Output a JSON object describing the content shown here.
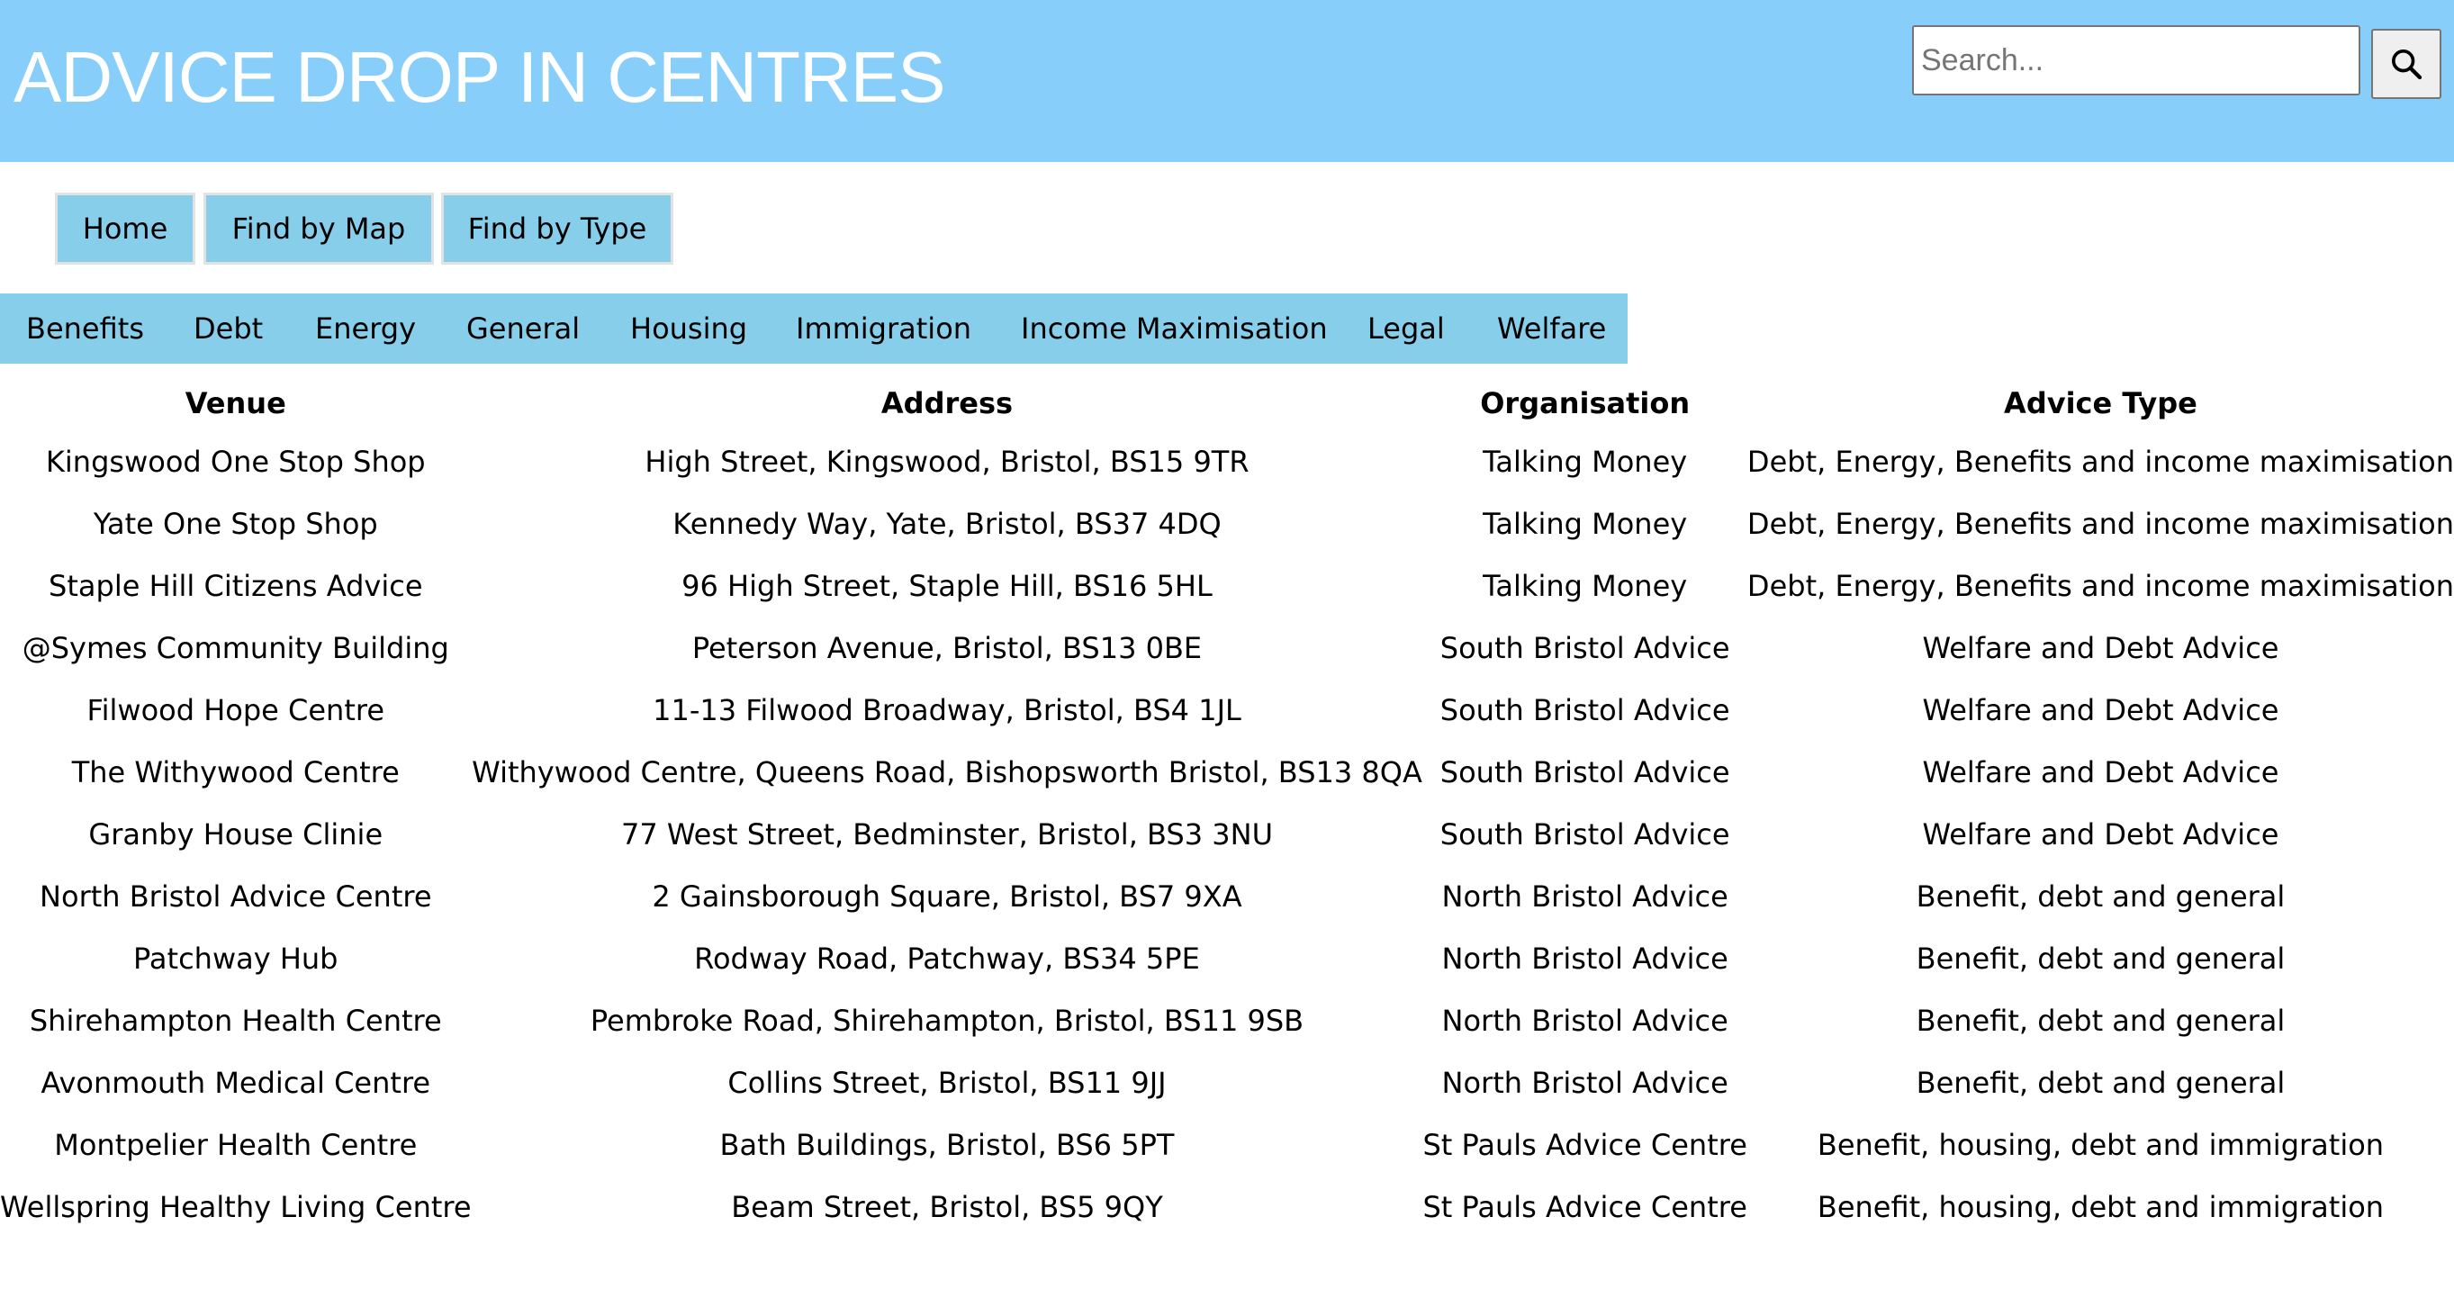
{
  "header": {
    "title": "ADVICE DROP IN CENTRES",
    "search_placeholder": "Search...",
    "search_button_icon": "search-icon",
    "background_color": "#87cefa"
  },
  "nav": {
    "items": [
      {
        "label": "Home"
      },
      {
        "label": "Find by Map"
      },
      {
        "label": "Find by Type"
      }
    ],
    "button_color": "#87ceeb"
  },
  "types": {
    "items": [
      {
        "label": "Benefits"
      },
      {
        "label": "Debt"
      },
      {
        "label": "Energy"
      },
      {
        "label": "General"
      },
      {
        "label": "Housing"
      },
      {
        "label": "Immigration"
      },
      {
        "label": "Income Maximisation"
      },
      {
        "label": "Legal"
      },
      {
        "label": "Welfare"
      }
    ]
  },
  "table": {
    "headers": [
      "Venue",
      "Address",
      "Organisation",
      "Advice Type"
    ],
    "rows": [
      [
        "Kingswood One Stop Shop",
        "High Street, Kingswood, Bristol, BS15 9TR",
        "Talking Money",
        "Debt, Energy, Benefits and income maximisation"
      ],
      [
        "Yate One Stop Shop",
        "Kennedy Way, Yate, Bristol, BS37 4DQ",
        "Talking Money",
        "Debt, Energy, Benefits and income maximisation"
      ],
      [
        "Staple Hill Citizens Advice",
        "96 High Street, Staple Hill, BS16 5HL",
        "Talking Money",
        "Debt, Energy, Benefits and income maximisation"
      ],
      [
        "@Symes Community Building",
        "Peterson Avenue, Bristol, BS13 0BE",
        "South Bristol Advice",
        "Welfare and Debt Advice"
      ],
      [
        "Filwood Hope Centre",
        "11-13 Filwood Broadway, Bristol, BS4 1JL",
        "South Bristol Advice",
        "Welfare and Debt Advice"
      ],
      [
        "The Withywood Centre",
        "Withywood Centre, Queens Road, Bishopsworth Bristol, BS13 8QA",
        "South Bristol Advice",
        "Welfare and Debt Advice"
      ],
      [
        "Granby House Clinie",
        "77 West Street, Bedminster, Bristol, BS3 3NU",
        "South Bristol Advice",
        "Welfare and Debt Advice"
      ],
      [
        "North Bristol Advice Centre",
        "2 Gainsborough Square, Bristol, BS7 9XA",
        "North Bristol Advice",
        "Benefit, debt and general"
      ],
      [
        "Patchway Hub",
        "Rodway Road, Patchway, BS34 5PE",
        "North Bristol Advice",
        "Benefit, debt and general"
      ],
      [
        "Shirehampton Health Centre",
        "Pembroke Road, Shirehampton, Bristol, BS11 9SB",
        "North Bristol Advice",
        "Benefit, debt and general"
      ],
      [
        "Avonmouth Medical Centre",
        "Collins Street, Bristol, BS11 9JJ",
        "North Bristol Advice",
        "Benefit, debt and general"
      ],
      [
        "Montpelier Health Centre",
        "Bath Buildings, Bristol, BS6 5PT",
        "St Pauls Advice Centre",
        "Benefit, housing, debt and immigration"
      ],
      [
        "Wellspring Healthy Living Centre",
        "Beam Street, Bristol, BS5 9QY",
        "St Pauls Advice Centre",
        "Benefit, housing, debt and immigration"
      ]
    ]
  }
}
